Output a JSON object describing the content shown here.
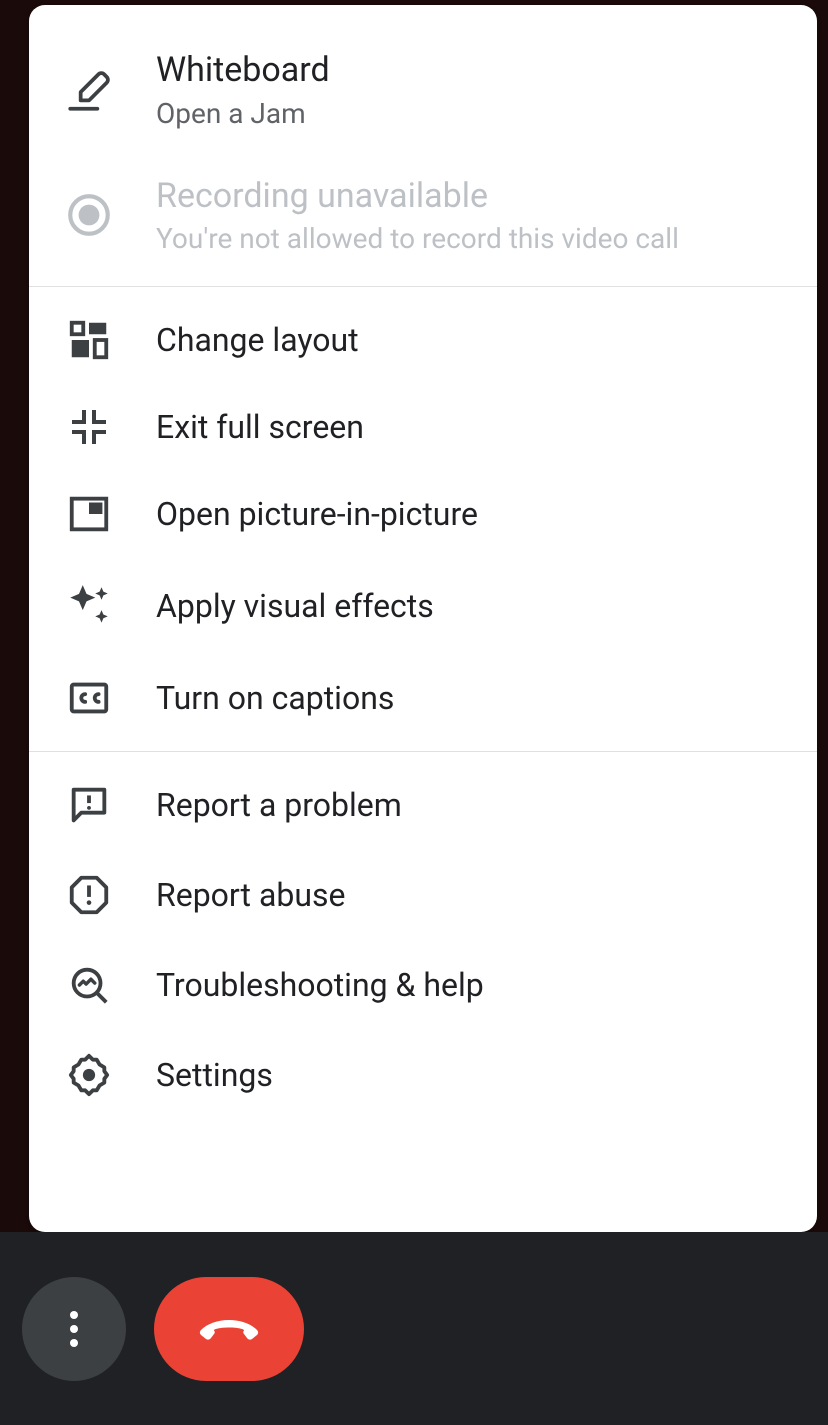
{
  "topItems": [
    {
      "title": "Whiteboard",
      "sub": "Open a Jam"
    },
    {
      "title": "Recording unavailable",
      "sub": "You're not allowed to record this video call"
    }
  ],
  "mainItems": {
    "changeLayout": "Change layout",
    "exitFullScreen": "Exit full screen",
    "pictureInPicture": "Open picture-in-picture",
    "visualEffects": "Apply visual effects",
    "captions": "Turn on captions"
  },
  "bottomItems": {
    "reportProblem": "Report a problem",
    "reportAbuse": "Report abuse",
    "troubleshooting": "Troubleshooting & help",
    "settings": "Settings"
  },
  "colors": {
    "hangup": "#ea4335"
  }
}
